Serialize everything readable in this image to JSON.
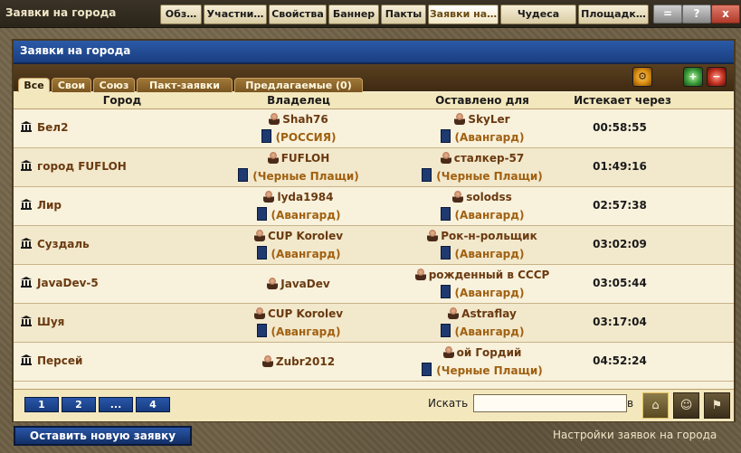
{
  "window": {
    "title": "Заявки на города",
    "tabs": [
      "Обз…",
      "Участни…",
      "Свойства",
      "Баннер",
      "Пакты",
      "Заявки на…",
      "Чудеса",
      "Площадк…"
    ],
    "active_tab": 5,
    "controls": [
      "=",
      "?",
      "x"
    ]
  },
  "panel": {
    "title": "Заявки на города",
    "subtabs": [
      "Все",
      "Свои",
      "Союз",
      "Пакт-заявки",
      "Предлагаемые (0)"
    ],
    "active_subtab": 0,
    "columns": {
      "city": "Город",
      "owner": "Владелец",
      "left_for": "Оставлено для",
      "expires": "Истекает через"
    },
    "rows": [
      {
        "city": "Бел2",
        "owner": "Shah76",
        "owner_alliance": "(РОССИЯ)",
        "left_for": "SkyLer",
        "left_for_alliance": "(Авангард)",
        "expires": "00:58:55"
      },
      {
        "city": "город FUFLOH",
        "owner": "FUFLOH",
        "owner_alliance": "(Черные Плащи)",
        "left_for": "сталкер-57",
        "left_for_alliance": "(Черные Плащи)",
        "expires": "01:49:16"
      },
      {
        "city": "Лир",
        "owner": "lyda1984",
        "owner_alliance": "(Авангард)",
        "left_for": "solodss",
        "left_for_alliance": "(Авангард)",
        "expires": "02:57:38"
      },
      {
        "city": "Суздаль",
        "owner": "CUP Korolev",
        "owner_alliance": "(Авангард)",
        "left_for": "Рок-н-рольщик",
        "left_for_alliance": "(Авангард)",
        "expires": "03:02:09"
      },
      {
        "city": "JavaDev-5",
        "owner": "JavaDev",
        "owner_alliance": "",
        "left_for": "рожденный в СССР",
        "left_for_alliance": "(Авангард)",
        "expires": "03:05:44"
      },
      {
        "city": "Шуя",
        "owner": "CUP Korolev",
        "owner_alliance": "(Авангард)",
        "left_for": "Astraflay",
        "left_for_alliance": "(Авангард)",
        "expires": "03:17:04"
      },
      {
        "city": "Персей",
        "owner": "Zubr2012",
        "owner_alliance": "",
        "left_for": "ой Гордий",
        "left_for_alliance": "(Черные Плащи)",
        "expires": "04:52:24"
      }
    ],
    "pagination": [
      "1",
      "2",
      "...",
      "4"
    ],
    "search": {
      "label": "Искать",
      "value": "",
      "in_label": "в"
    }
  },
  "bottom": {
    "new_request": "Оставить новую заявку",
    "settings_link": "Настройки заявок на города"
  },
  "colors": {
    "header_blue": "#1a3e80",
    "panel_bg": "#f8f1dc",
    "link_brown": "#6a3a10",
    "alliance_orange": "#a06010"
  },
  "icons": [
    "city-icon",
    "avatar-icon",
    "flag-icon",
    "settings-icon",
    "add-icon",
    "remove-icon",
    "search-city-icon",
    "search-player-icon",
    "search-alliance-icon"
  ]
}
